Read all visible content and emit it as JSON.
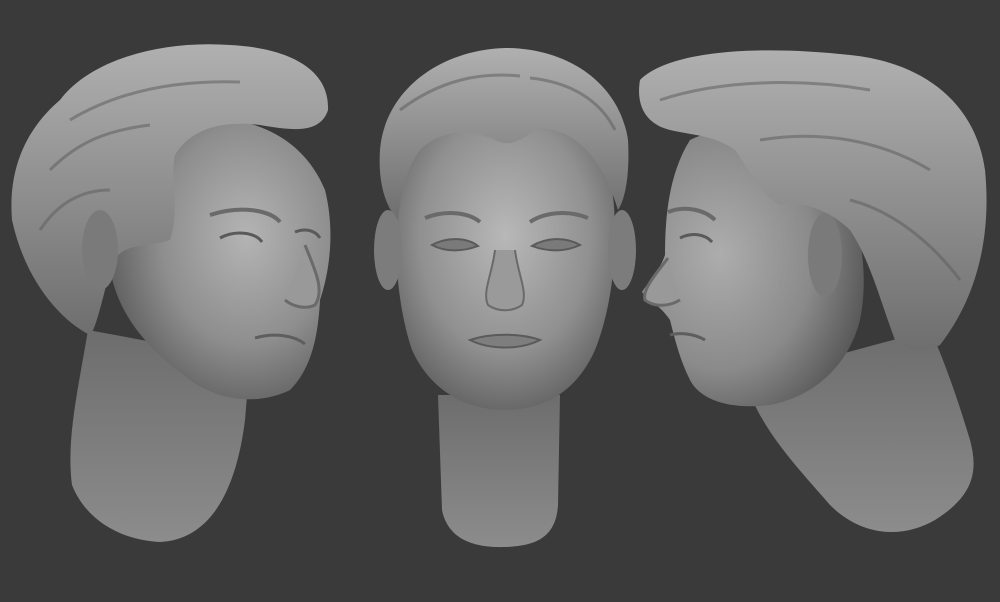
{
  "scene": {
    "background_color": "#3a3a3a",
    "material_color": "#8a8a8a",
    "views": [
      {
        "id": "left-three-quarter",
        "facing": "right"
      },
      {
        "id": "front",
        "facing": "viewer"
      },
      {
        "id": "right-profile",
        "facing": "left"
      }
    ]
  }
}
